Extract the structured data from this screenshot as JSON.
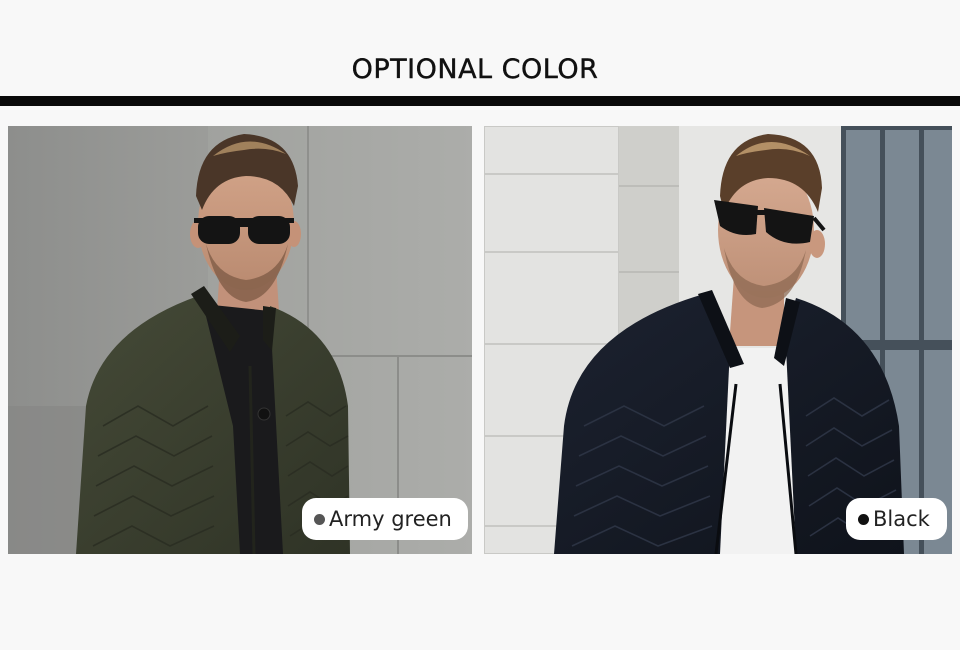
{
  "header": {
    "title": "OPTIONAL COLOR"
  },
  "options": [
    {
      "label": "Army green",
      "dot_color": "#555555",
      "jacket_color": "#3b3f30",
      "image": "man-army-green-jacket-photo"
    },
    {
      "label": "Black",
      "dot_color": "#111111",
      "jacket_color": "#151a24",
      "image": "man-black-jacket-photo"
    }
  ],
  "colors": {
    "page_background": "#f8f8f8",
    "rule": "#0a0a0a",
    "badge_background": "#ffffff"
  }
}
